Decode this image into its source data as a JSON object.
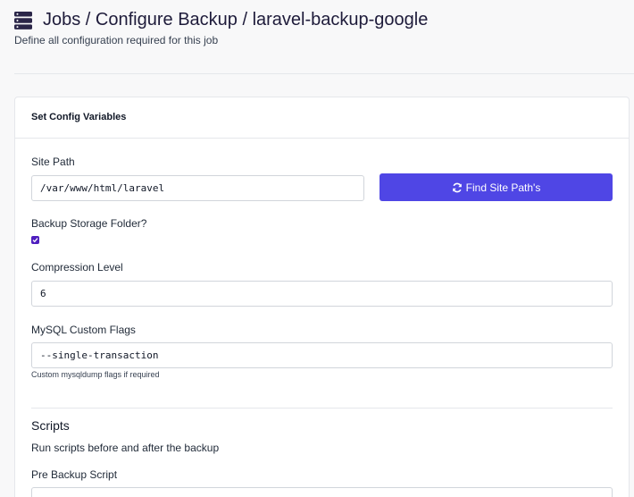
{
  "header": {
    "title": "Jobs / Configure Backup / laravel-backup-google",
    "subtitle": "Define all configuration required for this job",
    "icon": "server-icon"
  },
  "card": {
    "title": "Set Config Variables",
    "site_path": {
      "label": "Site Path",
      "value": "/var/www/html/laravel",
      "button_label": "Find Site Path's",
      "button_icon": "refresh-icon"
    },
    "backup_storage": {
      "label": "Backup Storage Folder?",
      "checked": true
    },
    "compression": {
      "label": "Compression Level",
      "value": "6"
    },
    "mysql_flags": {
      "label": "MySQL Custom Flags",
      "value": "--single-transaction",
      "help": "Custom mysqldump flags if required"
    },
    "scripts": {
      "title": "Scripts",
      "description": "Run scripts before and after the backup",
      "pre_backup_label": "Pre Backup Script"
    }
  },
  "colors": {
    "accent": "#4f46e5",
    "checkbox": "#4f1fbf",
    "title": "#1e1b3a"
  }
}
